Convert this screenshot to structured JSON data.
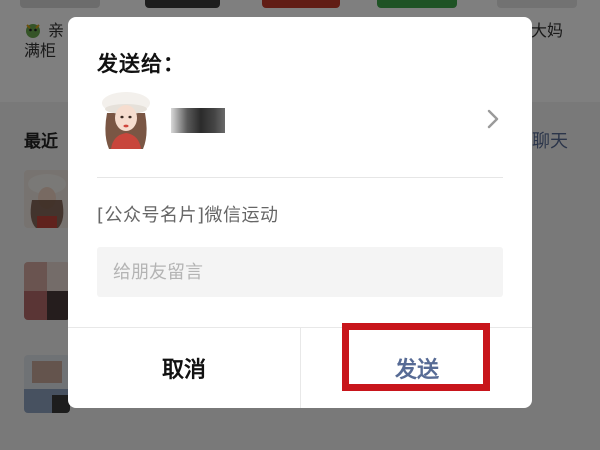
{
  "background": {
    "line1": "亲",
    "line2": "满柜",
    "right_fragment": "大妈",
    "recent_label": "最近",
    "new_chat_label": "聊天"
  },
  "dialog": {
    "title": "发送给：",
    "shared_item": "[公众号名片]微信运动",
    "message_input": {
      "placeholder": "给朋友留言",
      "value": ""
    },
    "cancel_label": "取消",
    "send_label": "发送"
  },
  "colors": {
    "link_blue": "#576b95",
    "highlight_red": "#c8151b",
    "mask": "rgba(0,0,0,0.5)"
  },
  "icons": {
    "recipient_avatar": "girl-in-white-hat-avatar",
    "chevron": "chevron-right-icon",
    "emoji": "dragon-emoji-icon"
  }
}
